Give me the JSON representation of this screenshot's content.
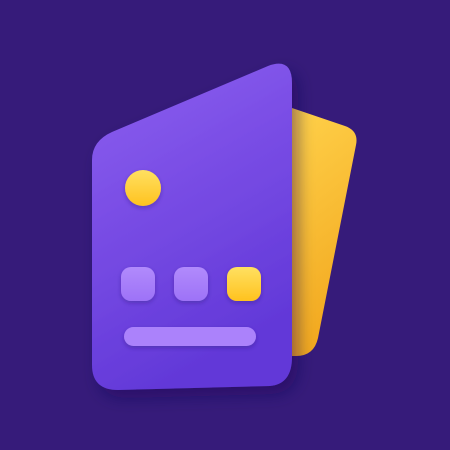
{
  "app_icon": {
    "name": "cards-app-icon",
    "colors": {
      "background": "#361b7a",
      "front_card_top": "#8d5ff0",
      "front_card_bottom": "#6238d8",
      "back_card_top": "#ffd14a",
      "back_card_bottom": "#f2a81f",
      "dot_yellow": "#ffd53d",
      "dot_purple": "#a77cfb",
      "bar_purple": "#ab82fb"
    },
    "icons": [
      "front-card-icon",
      "back-card-icon",
      "yellow-circle-icon",
      "purple-dot-icon",
      "yellow-dot-icon",
      "purple-bar-icon"
    ]
  }
}
